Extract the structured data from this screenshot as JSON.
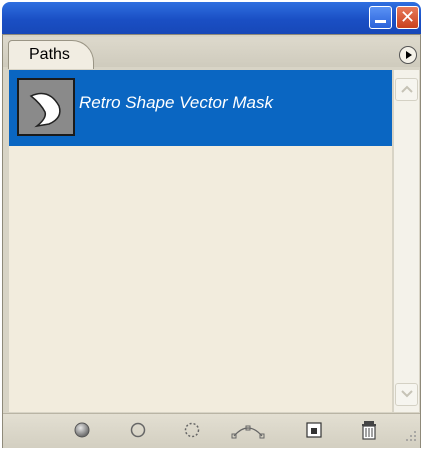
{
  "panel": {
    "tab_label": "Paths",
    "paths": [
      {
        "name": "Retro Shape Vector Mask",
        "selected": true
      }
    ]
  },
  "titlebar": {
    "close_glyph": "✕"
  },
  "icons": {
    "minimize": "minimize-icon",
    "close": "close-icon",
    "panel_menu": "panel-menu-arrow-icon",
    "fill_path": "fill-path-icon",
    "stroke_path": "stroke-path-icon",
    "load_selection": "load-path-as-selection-icon",
    "make_work_path": "make-work-path-icon",
    "new_path": "new-path-icon",
    "delete_path": "trash-icon"
  },
  "colors": {
    "selected_row": "#0a66c2",
    "list_background": "#f2ecdd",
    "titlebar": "#1a4fc4"
  }
}
